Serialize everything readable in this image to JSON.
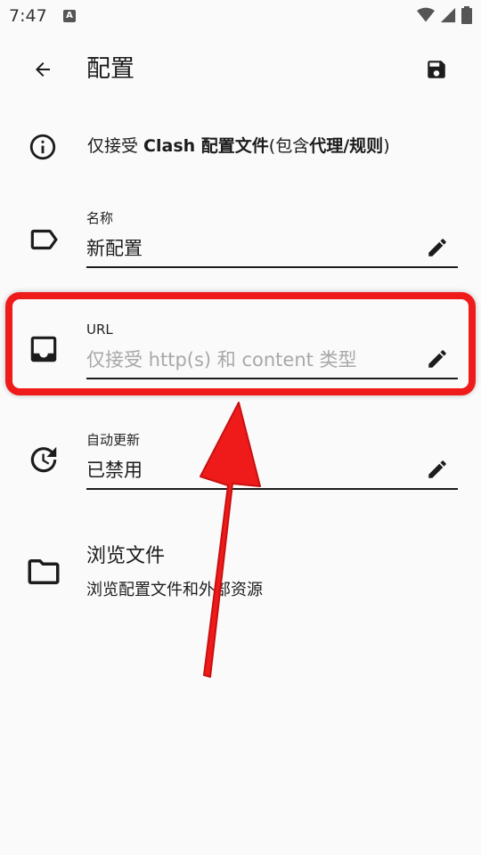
{
  "status_bar": {
    "time": "7:47",
    "notification_letter": "A"
  },
  "app_bar": {
    "title": "配置"
  },
  "info": {
    "part1": "仅接受 ",
    "part2": "Clash 配置文件",
    "part3": "(包含",
    "part4": "代理",
    "part5": "/",
    "part6": "规则",
    "part7": ")"
  },
  "fields": {
    "name": {
      "label": "名称",
      "value": "新配置"
    },
    "url": {
      "label": "URL",
      "placeholder": "仅接受 http(s) 和 content 类型"
    },
    "auto_update": {
      "label": "自动更新",
      "value": "已禁用"
    }
  },
  "browse": {
    "title": "浏览文件",
    "subtitle": "浏览配置文件和外部资源"
  },
  "colors": {
    "annotation_red": "#ef1b1b",
    "text": "#1c1c1c",
    "placeholder": "#a8a8a8"
  }
}
